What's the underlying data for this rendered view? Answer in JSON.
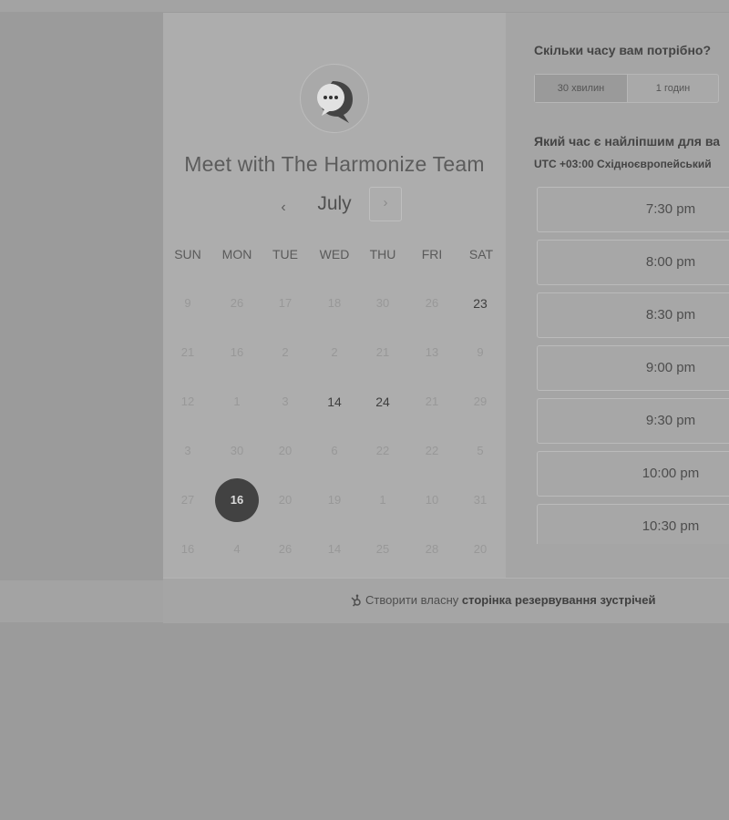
{
  "booking": {
    "title": "Meet with The Harmonize Team",
    "avatar_icon": "chat-bubble-icon"
  },
  "calendar": {
    "month": "July",
    "prev_icon": "chevron-left-icon",
    "next_icon": "chevron-right-icon",
    "weekdays": [
      "SUN",
      "MON",
      "TUE",
      "WED",
      "THU",
      "FRI",
      "SAT"
    ],
    "weeks": [
      [
        {
          "d": "9",
          "s": "disabled"
        },
        {
          "d": "26",
          "s": "disabled"
        },
        {
          "d": "17",
          "s": "disabled"
        },
        {
          "d": "18",
          "s": "disabled"
        },
        {
          "d": "30",
          "s": "disabled"
        },
        {
          "d": "26",
          "s": "disabled"
        },
        {
          "d": "23",
          "s": "available"
        }
      ],
      [
        {
          "d": "21",
          "s": "disabled"
        },
        {
          "d": "16",
          "s": "disabled"
        },
        {
          "d": "2",
          "s": "disabled"
        },
        {
          "d": "2",
          "s": "disabled"
        },
        {
          "d": "21",
          "s": "disabled"
        },
        {
          "d": "13",
          "s": "disabled"
        },
        {
          "d": "9",
          "s": "disabled"
        }
      ],
      [
        {
          "d": "12",
          "s": "disabled"
        },
        {
          "d": "1",
          "s": "disabled"
        },
        {
          "d": "3",
          "s": "disabled"
        },
        {
          "d": "14",
          "s": "available"
        },
        {
          "d": "24",
          "s": "available"
        },
        {
          "d": "21",
          "s": "disabled"
        },
        {
          "d": "29",
          "s": "disabled"
        }
      ],
      [
        {
          "d": "3",
          "s": "disabled"
        },
        {
          "d": "30",
          "s": "disabled"
        },
        {
          "d": "20",
          "s": "disabled"
        },
        {
          "d": "6",
          "s": "disabled"
        },
        {
          "d": "22",
          "s": "disabled"
        },
        {
          "d": "22",
          "s": "disabled"
        },
        {
          "d": "5",
          "s": "disabled"
        }
      ],
      [
        {
          "d": "27",
          "s": "disabled"
        },
        {
          "d": "16",
          "s": "selected"
        },
        {
          "d": "20",
          "s": "disabled"
        },
        {
          "d": "19",
          "s": "disabled"
        },
        {
          "d": "1",
          "s": "disabled"
        },
        {
          "d": "10",
          "s": "disabled"
        },
        {
          "d": "31",
          "s": "disabled"
        }
      ],
      [
        {
          "d": "16",
          "s": "disabled"
        },
        {
          "d": "4",
          "s": "disabled"
        },
        {
          "d": "26",
          "s": "disabled"
        },
        {
          "d": "14",
          "s": "disabled"
        },
        {
          "d": "25",
          "s": "disabled"
        },
        {
          "d": "28",
          "s": "disabled"
        },
        {
          "d": "20",
          "s": "disabled"
        }
      ]
    ]
  },
  "duration": {
    "question": "Скільки часу вам потрібно?",
    "options": [
      "30 хвилин",
      "1 годин"
    ],
    "selected": "30 хвилин"
  },
  "times": {
    "question": "Який час є найліпшим для ва",
    "timezone": "UTC +03:00 Східноєвропейський",
    "slots": [
      "7:30 pm",
      "8:00 pm",
      "8:30 pm",
      "9:00 pm",
      "9:30 pm",
      "10:00 pm",
      "10:30 pm"
    ]
  },
  "footer": {
    "prefix": "Створити власну",
    "link": "сторінка резервування зустрічей",
    "icon": "hubspot-sprocket-icon"
  }
}
